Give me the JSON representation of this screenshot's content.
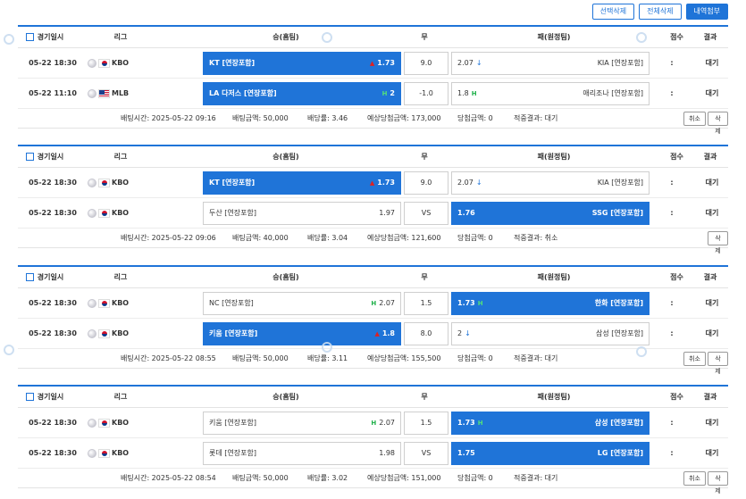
{
  "toolbar": {
    "select_delete": "선택삭제",
    "delete_all": "전체삭제",
    "history_attach": "내역첨부"
  },
  "header": {
    "date": "경기일시",
    "league": "리그",
    "home": "승(홈팀)",
    "draw": "무",
    "away": "패(원정팀)",
    "score": "점수",
    "result": "결과"
  },
  "colors": {
    "accent": "#1f74d8",
    "up": "#e02020",
    "h_mark": "#22b14c"
  },
  "slips": [
    {
      "rows": [
        {
          "date": "05-22 18:30",
          "league": "KBO",
          "flag": "kr",
          "home_name": "KT [연장포함]",
          "home_odds": "1.73",
          "home_mark": "▲",
          "home_sel": true,
          "draw": "9.0",
          "away_odds": "2.07",
          "away_mark": "↓",
          "away_name": "KIA [연장포함]",
          "away_sel": false,
          "score": ":",
          "result": "대기"
        },
        {
          "date": "05-22 11:10",
          "league": "MLB",
          "flag": "us",
          "home_name": "LA 다저스 [연장포함]",
          "home_odds": "2",
          "home_mark": "H",
          "home_sel": true,
          "draw": "-1.0",
          "away_odds": "1.8",
          "away_mark": "H",
          "away_name": "애리조나 [연장포함]",
          "away_sel": false,
          "score": ":",
          "result": "대기"
        }
      ],
      "info": {
        "time": "배팅시간: 2025-05-22 09:16",
        "amount": "배팅금액: 50,000",
        "rate": "배당률: 3.46",
        "expected": "예상당첨금액: 173,000",
        "win": "당첨금액: 0",
        "hit": "적중결과: 대기"
      },
      "buttons": {
        "cancel": "취소",
        "delete": "삭제"
      }
    },
    {
      "rows": [
        {
          "date": "05-22 18:30",
          "league": "KBO",
          "flag": "kr",
          "home_name": "KT [연장포함]",
          "home_odds": "1.73",
          "home_mark": "▲",
          "home_sel": true,
          "draw": "9.0",
          "away_odds": "2.07",
          "away_mark": "↓",
          "away_name": "KIA [연장포함]",
          "away_sel": false,
          "score": ":",
          "result": "대기"
        },
        {
          "date": "05-22 18:30",
          "league": "KBO",
          "flag": "kr",
          "home_name": "두산 [연장포함]",
          "home_odds": "1.97",
          "home_mark": "",
          "home_sel": false,
          "draw": "VS",
          "away_odds": "1.76",
          "away_mark": "",
          "away_name": "SSG [연장포함]",
          "away_sel": true,
          "score": ":",
          "result": "대기"
        }
      ],
      "info": {
        "time": "배팅시간: 2025-05-22 09:06",
        "amount": "배팅금액: 40,000",
        "rate": "배당률: 3.04",
        "expected": "예상당첨금액: 121,600",
        "win": "당첨금액: 0",
        "hit": "적중결과: 취소"
      },
      "buttons": {
        "delete": "삭제"
      }
    },
    {
      "rows": [
        {
          "date": "05-22 18:30",
          "league": "KBO",
          "flag": "kr",
          "home_name": "NC [연장포함]",
          "home_odds": "2.07",
          "home_mark": "H",
          "home_sel": false,
          "draw": "1.5",
          "away_odds": "1.73",
          "away_mark": "H",
          "away_name": "한화 [연장포함]",
          "away_sel": true,
          "score": ":",
          "result": "대기"
        },
        {
          "date": "05-22 18:30",
          "league": "KBO",
          "flag": "kr",
          "home_name": "키움 [연장포함]",
          "home_odds": "1.8",
          "home_mark": "▲",
          "home_sel": true,
          "draw": "8.0",
          "away_odds": "2",
          "away_mark": "↓",
          "away_name": "삼성 [연장포함]",
          "away_sel": false,
          "score": ":",
          "result": "대기"
        }
      ],
      "info": {
        "time": "배팅시간: 2025-05-22 08:55",
        "amount": "배팅금액: 50,000",
        "rate": "배당률: 3.11",
        "expected": "예상당첨금액: 155,500",
        "win": "당첨금액: 0",
        "hit": "적중결과: 대기"
      },
      "buttons": {
        "cancel": "취소",
        "delete": "삭제"
      }
    },
    {
      "rows": [
        {
          "date": "05-22 18:30",
          "league": "KBO",
          "flag": "kr",
          "home_name": "키움 [연장포함]",
          "home_odds": "2.07",
          "home_mark": "H",
          "home_sel": false,
          "draw": "1.5",
          "away_odds": "1.73",
          "away_mark": "H",
          "away_name": "삼성 [연장포함]",
          "away_sel": true,
          "score": ":",
          "result": "대기"
        },
        {
          "date": "05-22 18:30",
          "league": "KBO",
          "flag": "kr",
          "home_name": "롯데 [연장포함]",
          "home_odds": "1.98",
          "home_mark": "",
          "home_sel": false,
          "draw": "VS",
          "away_odds": "1.75",
          "away_mark": "",
          "away_name": "LG [연장포함]",
          "away_sel": true,
          "score": ":",
          "result": "대기"
        }
      ],
      "info": {
        "time": "배팅시간: 2025-05-22 08:54",
        "amount": "배팅금액: 50,000",
        "rate": "배당률: 3.02",
        "expected": "예상당첨금액: 151,000",
        "win": "당첨금액: 0",
        "hit": "적중결과: 대기"
      },
      "buttons": {
        "cancel": "취소",
        "delete": "삭제"
      }
    }
  ]
}
